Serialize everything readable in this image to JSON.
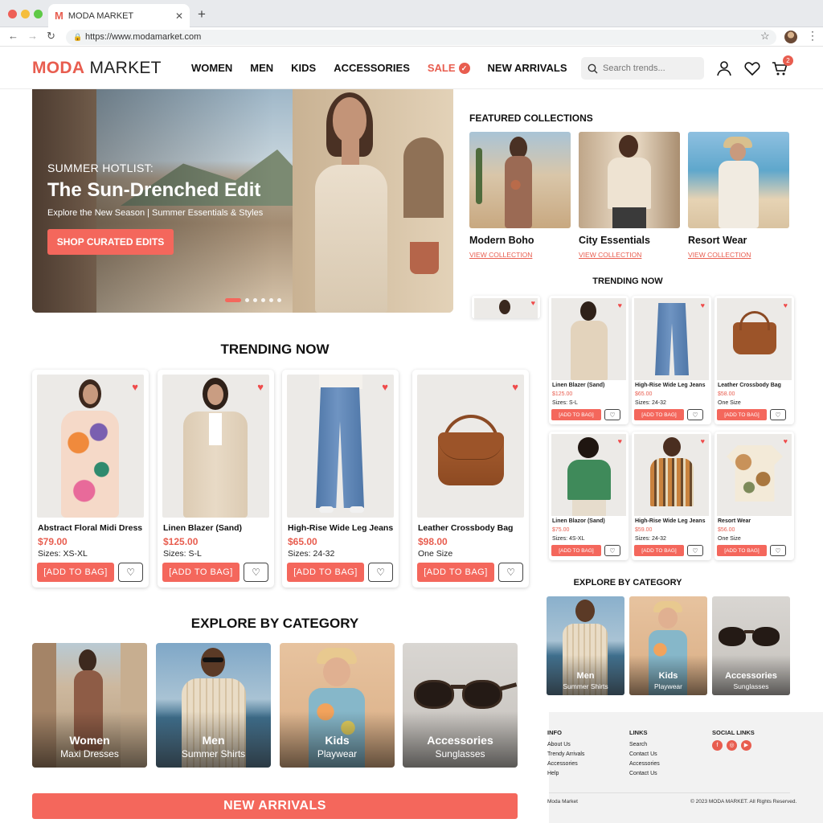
{
  "browser": {
    "tab_title": "MODA MARKET",
    "tab_favicon": "M",
    "url": "https://www.modamarket.com"
  },
  "header": {
    "logo_part1": "MODA",
    "logo_part2": "MARKET",
    "nav": [
      "WOMEN",
      "MEN",
      "KIDS",
      "ACCESSORIES",
      "SALE",
      "NEW ARRIVALS"
    ],
    "search_placeholder": "Search trends...",
    "cart_count": "2"
  },
  "hero": {
    "kicker": "SUMMER HOTLIST:",
    "title": "The Sun-Drenched Edit",
    "subtitle": "Explore the New Season | Summer Essentials & Styles",
    "button": "SHOP CURATED EDITS"
  },
  "trending": {
    "title": "TRENDING NOW",
    "add_label": "[ADD TO BAG]",
    "products": [
      {
        "name": "Abstract Floral Midi Dress",
        "price": "$79.00",
        "sizes": "Sizes: XS-XL"
      },
      {
        "name": "Linen Blazer (Sand)",
        "price": "$125.00",
        "sizes": "Sizes: S-L"
      },
      {
        "name": "High-Rise Wide Leg Jeans",
        "price": "$65.00",
        "sizes": "Sizes: 24-32"
      },
      {
        "name": "Leather Crossbody Bag",
        "price": "$98.00",
        "sizes": "One Size"
      }
    ]
  },
  "categories": {
    "title": "EXPLORE BY CATEGORY",
    "items": [
      {
        "name": "Women",
        "sub": "Maxi Dresses"
      },
      {
        "name": "Men",
        "sub": "Summer Shirts"
      },
      {
        "name": "Kids",
        "sub": "Playwear"
      },
      {
        "name": "Accessories",
        "sub": "Sunglasses"
      }
    ]
  },
  "new_arrivals_button": "NEW ARRIVALS",
  "featured": {
    "title": "FEATURED COLLECTIONS",
    "link_label": "VIEW COLLECTION",
    "items": [
      {
        "name": "Modern Boho"
      },
      {
        "name": "City Essentials"
      },
      {
        "name": "Resort Wear"
      }
    ]
  },
  "mobile_trending": {
    "title": "TRENDING NOW",
    "add_label": "[ADD TO BAG]",
    "products": [
      {
        "name": "Linen Blazer (Sand)",
        "price": "$125.00",
        "sizes": "Sizes: S-L"
      },
      {
        "name": "High-Rise Wide Leg Jeans",
        "price": "$65.00",
        "sizes": "Sizes: 24-32"
      },
      {
        "name": "Leather Crossbody Bag",
        "price": "$58.00",
        "sizes": "One Size"
      },
      {
        "name": "Linen Blazor (Sand)",
        "price": "$75.00",
        "sizes": "Sizes: 4S-XL"
      },
      {
        "name": "High-Rise Wide Leg Jeans",
        "price": "$59.00",
        "sizes": "Sizes: 24-32"
      },
      {
        "name": "Resort Wear",
        "price": "$56.00",
        "sizes": "One Size"
      }
    ]
  },
  "mobile_categories": {
    "title": "EXPLORE BY CATEGORY",
    "items": [
      {
        "name": "Men",
        "sub": "Summer Shirts"
      },
      {
        "name": "Kids",
        "sub": "Playwear"
      },
      {
        "name": "Accessories",
        "sub": "Sunglasses"
      }
    ]
  },
  "footer": {
    "col1_title": "INFO",
    "col1": [
      "About Us",
      "Trendy Arrivals",
      "Accessories",
      "Help"
    ],
    "col2_title": "LINKS",
    "col2": [
      "Search",
      "Contact Us",
      "Accessories",
      "Contact Us"
    ],
    "col3_title": "SOCIAL LINKS",
    "social": [
      "facebook-icon",
      "instagram-icon",
      "youtube-icon"
    ],
    "left_text": "Moda Market",
    "copyright": "© 2023 MODA MARKET. All Rights Reserved."
  },
  "colors": {
    "accent": "#f4675c",
    "brand": "#e85d4f",
    "heart": "#ef4b4b"
  }
}
